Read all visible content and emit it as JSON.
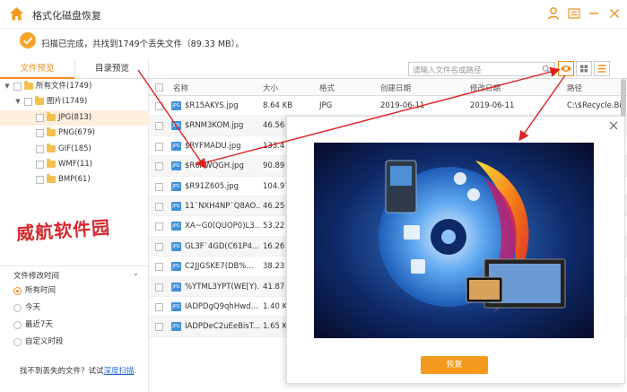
{
  "app": {
    "title": "格式化磁盘恢复"
  },
  "status": {
    "text": "扫描已完成，共找到1749个丢失文件（89.33 MB）。"
  },
  "sidebar": {
    "tabs": [
      {
        "label": "文件预览"
      },
      {
        "label": "目录预览"
      }
    ],
    "tree": [
      {
        "label": "所有文件(1749)"
      },
      {
        "label": "图片(1749)"
      },
      {
        "label": "JPG(813)"
      },
      {
        "label": "PNG(679)"
      },
      {
        "label": "GIF(185)"
      },
      {
        "label": "WMF(11)"
      },
      {
        "label": "BMP(61)"
      }
    ],
    "watermark": "威航软件园",
    "filter": {
      "title": "文件修改时间",
      "options": [
        {
          "label": "所有时间",
          "selected": true
        },
        {
          "label": "今天",
          "selected": false
        },
        {
          "label": "最近7天",
          "selected": false
        },
        {
          "label": "自定义时段",
          "selected": false
        }
      ]
    },
    "hint": {
      "text": "找不到丢失的文件？试试",
      "link": "深度扫描",
      "end": "."
    }
  },
  "toolbar": {
    "search_placeholder": "请输入文件名或路径"
  },
  "table": {
    "headers": {
      "name": "名称",
      "size": "大小",
      "format": "格式",
      "created": "创建日期",
      "modified": "修改日期",
      "path": "路径"
    },
    "rows": [
      {
        "name": "$R15AKYS.jpg",
        "size": "8.64 KB",
        "format": "JPG",
        "created": "2019-06-11",
        "modified": "2019-06-11",
        "path": "C:\\$Recycle.Bi..."
      },
      {
        "name": "$RNM3KOM.jpg",
        "size": "46.56"
      },
      {
        "name": "$RYFMADU.jpg",
        "size": "133.4"
      },
      {
        "name": "$R0AWQGH.jpg",
        "size": "90.89"
      },
      {
        "name": "$R91Z605.jpg",
        "size": "104.97"
      },
      {
        "name": "11`NXH4NP`Q8AO...",
        "size": "46.25"
      },
      {
        "name": "XA~G0(QUOP0)L3...",
        "size": "53.22"
      },
      {
        "name": "GL3F`4GD(C61P4...",
        "size": "16.26"
      },
      {
        "name": "C2JJGSKE7(DB%...",
        "size": "38.23"
      },
      {
        "name": "%YTML3YPT(WE[Y)...",
        "size": "41.87"
      },
      {
        "name": "IADPDgQ9qhHwd...",
        "size": "1.40 KB"
      },
      {
        "name": "IADPDeC2uEeBisT...",
        "size": "1.65 KB"
      }
    ]
  },
  "preview": {
    "recover_label": "恢复"
  },
  "colors": {
    "accent": "#f08c1b",
    "button": "#f39a1e",
    "arrow": "#e02020",
    "link": "#2a6ad6"
  }
}
